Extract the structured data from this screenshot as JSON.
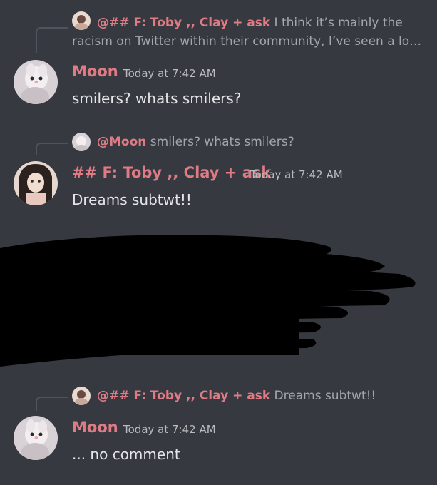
{
  "messages": [
    {
      "reply": {
        "name": "@## F: Toby ,, Clay + ask",
        "text_line1": "I think it’s mainly the",
        "text_line2": "racism on Twitter within their community, I’ve seen a lo…"
      },
      "author": "Moon",
      "time": "Today at 7:42 AM",
      "content": "smilers? whats smilers?"
    },
    {
      "reply": {
        "name": "@Moon",
        "text": "smilers? whats smilers?"
      },
      "author": "## F: Toby ,, Clay + ask",
      "time": "Today at 7:42 AM",
      "content": "Dreams subtwt!!"
    },
    {
      "reply": {
        "name": "@## F: Toby ,, Clay + ask",
        "text": "Dreams subtwt!!"
      },
      "author": "Moon",
      "time": "Today at 7:42 AM",
      "content": "... no comment"
    }
  ],
  "colors": {
    "background": "#36393f",
    "username": "#e07b85",
    "text": "#e3e5e8",
    "muted": "#a3a6aa"
  }
}
